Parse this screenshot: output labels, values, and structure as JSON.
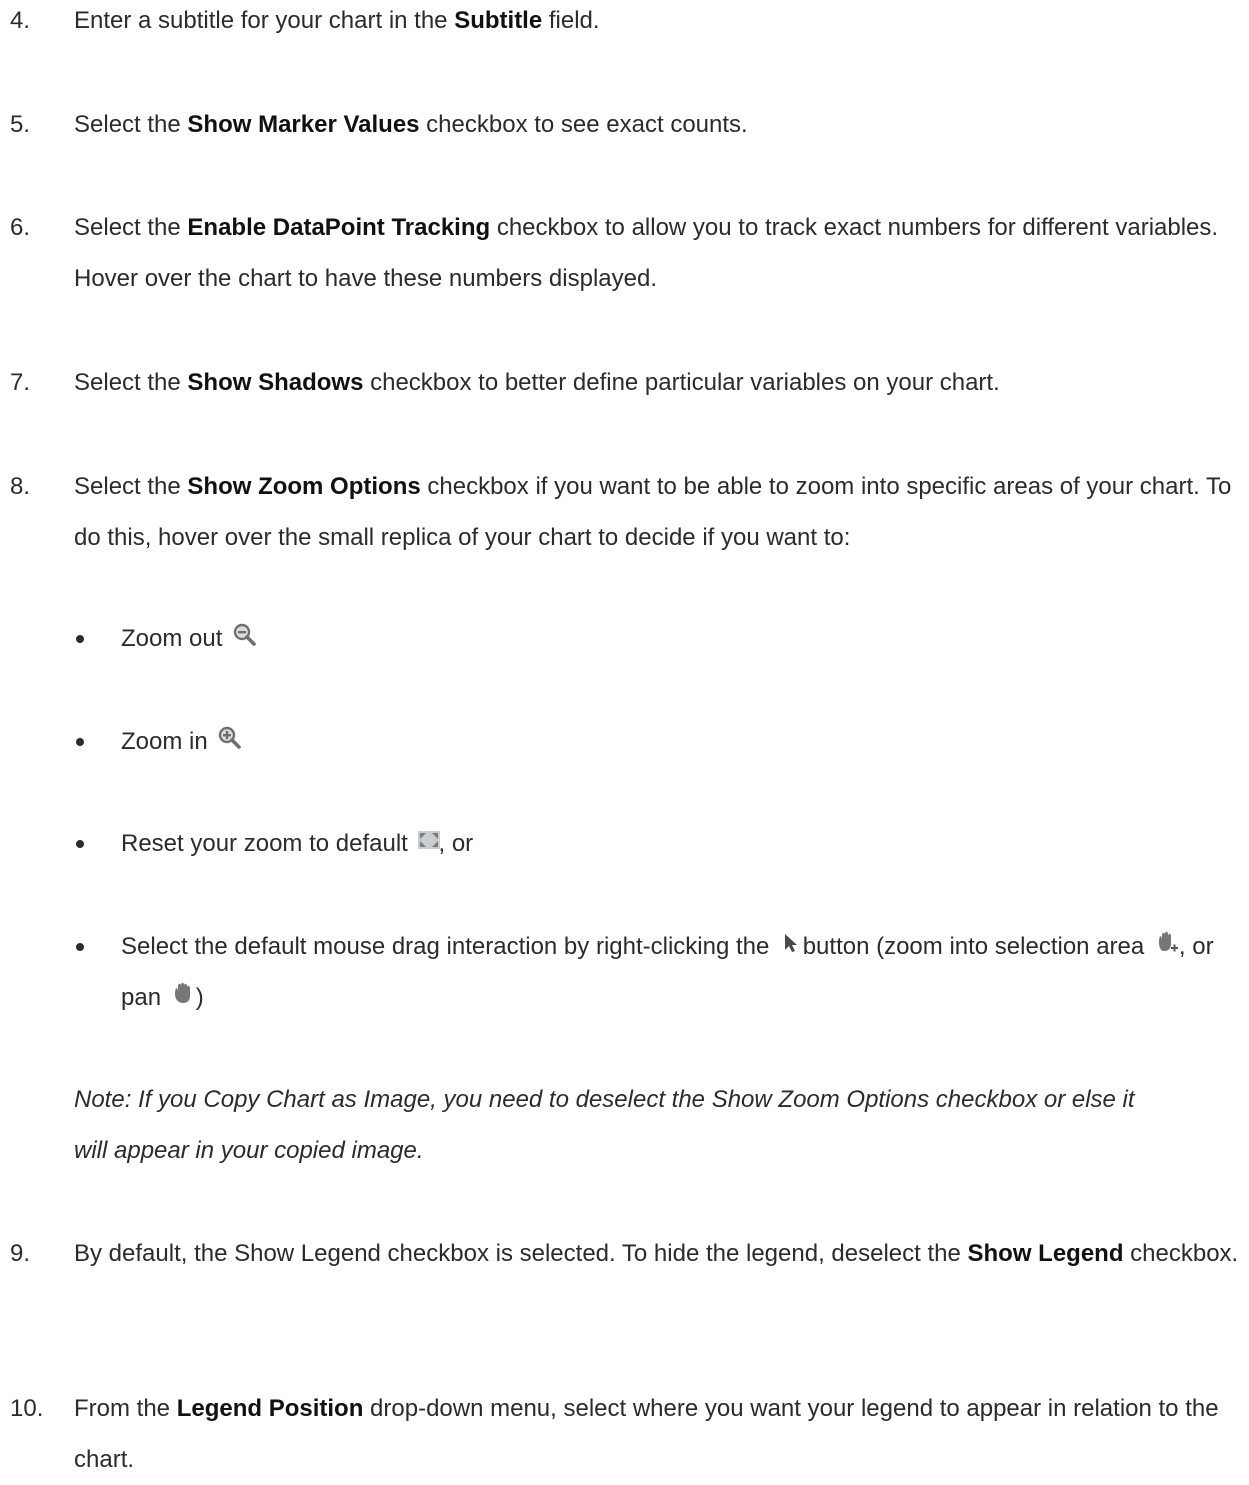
{
  "steps": [
    {
      "num": "4.",
      "pre": "Enter a subtitle for your chart in the ",
      "bold": "Subtitle",
      "post": " field."
    },
    {
      "num": "5.",
      "pre": "Select the ",
      "bold": "Show Marker Values",
      "post": " checkbox to see exact counts."
    },
    {
      "num": "6.",
      "pre": "Select the ",
      "bold": "Enable DataPoint Tracking",
      "post": " checkbox to allow you to track exact numbers for different variables. Hover over the chart to have these numbers displayed."
    },
    {
      "num": "7.",
      "pre": "Select the ",
      "bold": "Show Shadows",
      "post": " checkbox to better define particular variables on your chart."
    },
    {
      "num": "8.",
      "pre": "Select the ",
      "bold": "Show Zoom Options",
      "post": " checkbox if you want to be able to zoom into specific areas of your chart. To do this, hover over the small replica of your chart to decide if you want to:"
    },
    {
      "num": "9.",
      "pre": "By default, the Show Legend checkbox is selected. To hide the legend, deselect the ",
      "bold": "Show Legend",
      "post": " checkbox."
    },
    {
      "num": "10.",
      "pre": "From the ",
      "bold": "Legend Position",
      "post": " drop-down menu, select where you want your legend to appear in relation to the chart."
    }
  ],
  "bullets": {
    "zoom_out": {
      "text": "Zoom out ",
      "icon": "zoom-out-icon"
    },
    "zoom_in": {
      "text": "Zoom in ",
      "icon": "zoom-in-icon"
    },
    "reset": {
      "text": "Reset your zoom to default ",
      "after": ", or",
      "icon": "reset-zoom-icon"
    },
    "drag": {
      "text1": "Select the default mouse drag interaction by right-clicking the ",
      "text2": " button (zoom into selection area ",
      "text3": ", or pan ",
      "text4": ")",
      "icons": [
        "pointer-icon",
        "zoom-selection-hand-icon",
        "pan-hand-icon"
      ]
    }
  },
  "note": {
    "line1": "Note: If you Copy Chart as Image, you need to deselect the Show Zoom Options checkbox or else it",
    "line2": "will appear in your copied image."
  },
  "colors": {
    "text": "#2b2b2b",
    "bold": "#111111",
    "icon_gray": "#8a8a8a"
  }
}
